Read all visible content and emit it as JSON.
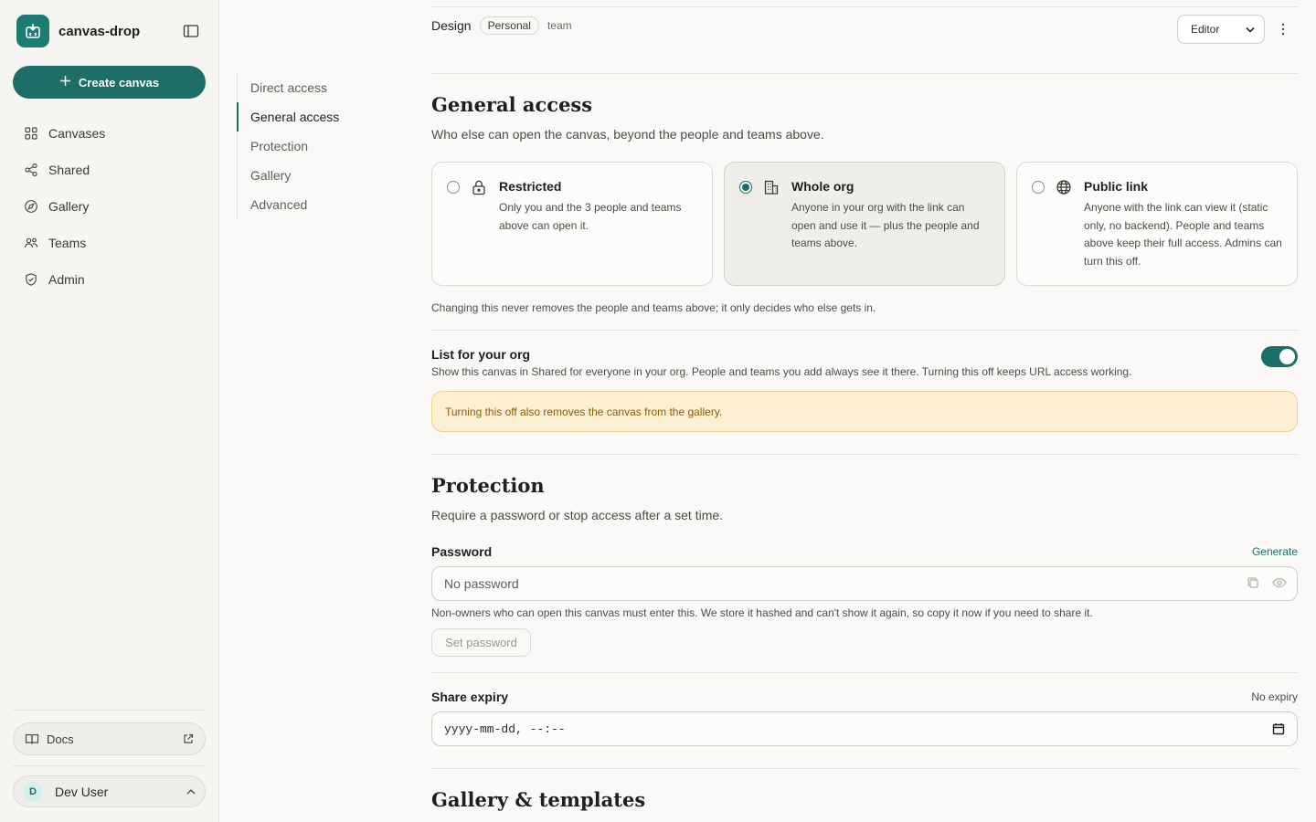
{
  "app": {
    "name": "canvas-drop"
  },
  "sidebar": {
    "create_label": "Create canvas",
    "items": [
      {
        "label": "Canvases",
        "icon": "grid-icon"
      },
      {
        "label": "Shared",
        "icon": "share-icon"
      },
      {
        "label": "Gallery",
        "icon": "compass-icon"
      },
      {
        "label": "Teams",
        "icon": "people-icon"
      },
      {
        "label": "Admin",
        "icon": "shield-icon"
      }
    ],
    "docs_label": "Docs",
    "user": {
      "initial": "D",
      "name": "Dev User"
    }
  },
  "section_nav": {
    "items": [
      "Direct access",
      "General access",
      "Protection",
      "Gallery",
      "Advanced"
    ],
    "active": "General access"
  },
  "header": {
    "label": "Design",
    "pill": "Personal",
    "tag": "team",
    "role_value": "Editor"
  },
  "general_access": {
    "title": "General access",
    "subtitle": "Who else can open the canvas, beyond the people and teams above.",
    "options": [
      {
        "title": "Restricted",
        "desc": "Only you and the 3 people and teams above can open it.",
        "icon": "lock-icon",
        "selected": false
      },
      {
        "title": "Whole org",
        "desc": "Anyone in your org with the link can open and use it — plus the people and teams above.",
        "icon": "building-icon",
        "selected": true
      },
      {
        "title": "Public link",
        "desc": "Anyone with the link can view it (static only, no backend). People and teams above keep their full access. Admins can turn this off.",
        "icon": "globe-icon",
        "selected": false
      }
    ],
    "note": "Changing this never removes the people and teams above; it only decides who else gets in."
  },
  "list_for_org": {
    "title": "List for your org",
    "desc": "Show this canvas in Shared for everyone in your org. People and teams you add always see it there. Turning this off keeps URL access working.",
    "enabled": true,
    "warning": "Turning this off also removes the canvas from the gallery."
  },
  "protection": {
    "title": "Protection",
    "subtitle": "Require a password or stop access after a set time.",
    "password_label": "Password",
    "generate_label": "Generate",
    "password_placeholder": "No password",
    "password_help": "Non-owners who can open this canvas must enter this. We store it hashed and can't show it again, so copy it now if you need to share it.",
    "set_password_label": "Set password",
    "expiry_label": "Share expiry",
    "expiry_state": "No expiry",
    "expiry_placeholder": "yyyy-mm-dd, --:--"
  },
  "gallery": {
    "title": "Gallery & templates"
  },
  "colors": {
    "accent": "#1b6f66",
    "warning_bg": "#fdf0d2",
    "warning_text": "#8a5a06"
  }
}
